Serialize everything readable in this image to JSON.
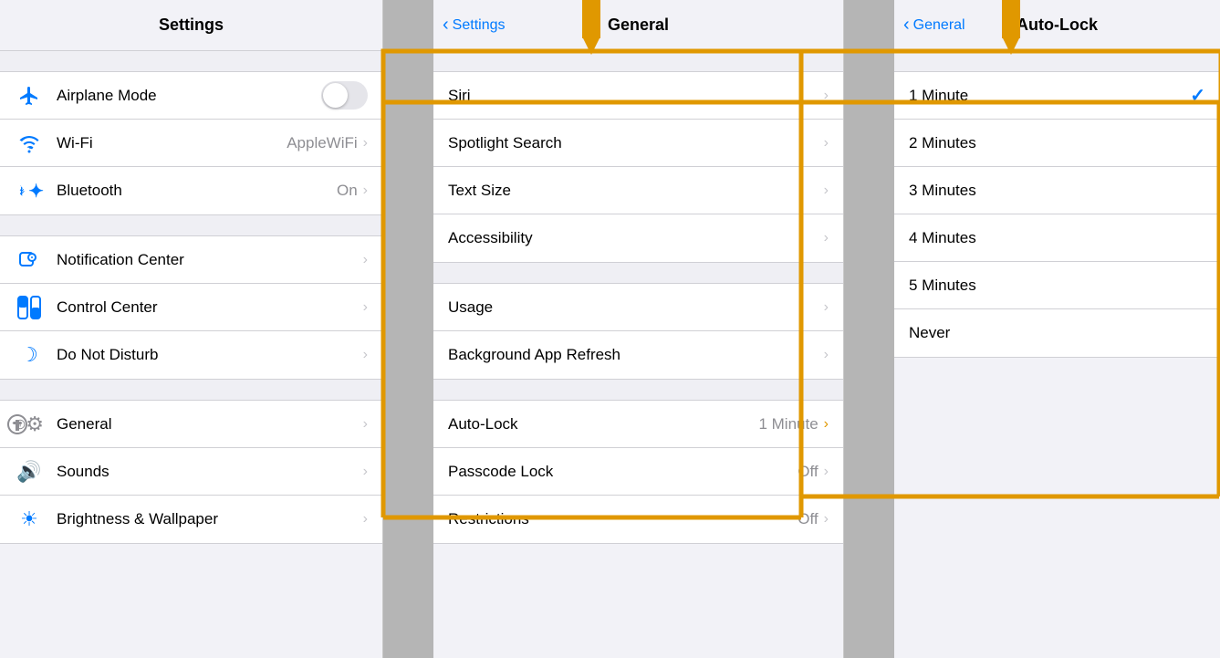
{
  "settings": {
    "title": "Settings",
    "items_group1": [
      {
        "id": "airplane",
        "label": "Airplane Mode",
        "icon": "✈",
        "value": "",
        "has_toggle": true,
        "toggle_on": false,
        "has_chevron": false
      },
      {
        "id": "wifi",
        "label": "Wi-Fi",
        "icon": "wifi",
        "value": "AppleWiFi",
        "has_chevron": true
      },
      {
        "id": "bluetooth",
        "label": "Bluetooth",
        "icon": "bt",
        "value": "On",
        "has_chevron": true
      }
    ],
    "items_group2": [
      {
        "id": "notification",
        "label": "Notification Center",
        "icon": "notif",
        "value": "",
        "has_chevron": true
      },
      {
        "id": "control",
        "label": "Control Center",
        "icon": "control",
        "value": "",
        "has_chevron": true
      },
      {
        "id": "donotdisturb",
        "label": "Do Not Disturb",
        "icon": "moon",
        "value": "",
        "has_chevron": true
      }
    ],
    "items_group3": [
      {
        "id": "general",
        "label": "General",
        "icon": "gear",
        "value": "",
        "has_chevron": true
      },
      {
        "id": "sounds",
        "label": "Sounds",
        "icon": "sound",
        "value": "",
        "has_chevron": true
      },
      {
        "id": "brightness",
        "label": "Brightness & Wallpaper",
        "icon": "sun",
        "value": "",
        "has_chevron": true
      }
    ]
  },
  "general": {
    "title": "General",
    "back_label": "Settings",
    "items_group1": [
      {
        "id": "siri",
        "label": "Siri",
        "value": "",
        "has_chevron": true
      },
      {
        "id": "spotlight",
        "label": "Spotlight Search",
        "value": "",
        "has_chevron": true
      },
      {
        "id": "textsize",
        "label": "Text Size",
        "value": "",
        "has_chevron": true
      },
      {
        "id": "accessibility",
        "label": "Accessibility",
        "value": "",
        "has_chevron": true
      }
    ],
    "items_group2": [
      {
        "id": "usage",
        "label": "Usage",
        "value": "",
        "has_chevron": true
      },
      {
        "id": "bgapprefresh",
        "label": "Background App Refresh",
        "value": "",
        "has_chevron": true
      }
    ],
    "items_group3": [
      {
        "id": "autolock",
        "label": "Auto-Lock",
        "value": "1 Minute",
        "has_chevron": true
      },
      {
        "id": "passcodelock",
        "label": "Passcode Lock",
        "value": "Off",
        "has_chevron": true
      },
      {
        "id": "restrictions",
        "label": "Restrictions",
        "value": "Off",
        "has_chevron": true
      }
    ]
  },
  "autolock": {
    "title": "Auto-Lock",
    "back_label": "General",
    "options": [
      {
        "id": "1min",
        "label": "1 Minute",
        "selected": true
      },
      {
        "id": "2min",
        "label": "2 Minutes",
        "selected": false
      },
      {
        "id": "3min",
        "label": "3 Minutes",
        "selected": false
      },
      {
        "id": "4min",
        "label": "4 Minutes",
        "selected": false
      },
      {
        "id": "5min",
        "label": "5 Minutes",
        "selected": false
      },
      {
        "id": "never",
        "label": "Never",
        "selected": false
      }
    ]
  }
}
